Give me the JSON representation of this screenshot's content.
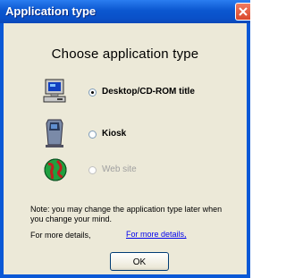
{
  "window": {
    "title": "Application type",
    "close_icon": "close-icon"
  },
  "heading": "Choose application type",
  "options": [
    {
      "label": "Desktop/CD-ROM title",
      "icon": "desktop-computer-icon",
      "selected": true,
      "enabled": true
    },
    {
      "label": "Kiosk",
      "icon": "kiosk-icon",
      "selected": false,
      "enabled": true
    },
    {
      "label": "Web site",
      "icon": "globe-icon",
      "selected": false,
      "enabled": false
    }
  ],
  "note": "Note: you may change the application type later when you change your mind.",
  "details": {
    "label": "For more details,",
    "link": "For more details,"
  },
  "ok_label": "OK",
  "colors": {
    "title_bar": "#0a58d6",
    "dialog_bg": "#ece9d8",
    "link": "#0000ee",
    "close_button": "#d9482b"
  }
}
